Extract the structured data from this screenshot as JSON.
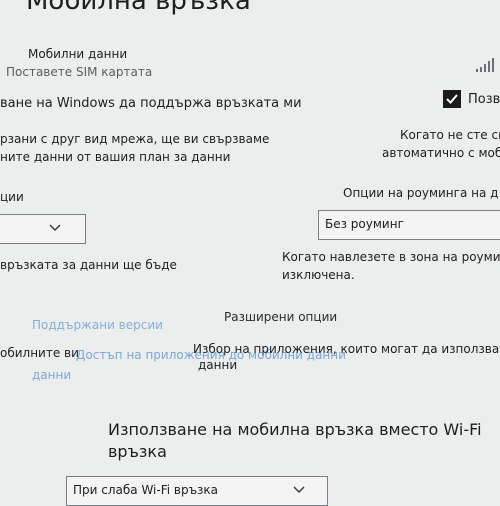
{
  "page": {
    "title": "Мобилна връзка"
  },
  "mobile_data": {
    "label": "Мобилни данни",
    "status": "Поставете SIM картата",
    "signal_icon": "signal-bars-icon"
  },
  "windows_manage": {
    "label_left": "ване на Windows да поддържа връзката ми",
    "checkbox_label": "Позво",
    "checked": true
  },
  "auto_switch": {
    "left_line1": "рзани с друг вид мрежа, ще ви свързваме",
    "left_line2": "ните данни от вашия план за данни",
    "right_line1": "Когато не сте св",
    "right_line2": "автоматично с моб"
  },
  "roaming": {
    "options_label": "Опции на роуминга на д",
    "left_label": "ции",
    "dropdown_value": "Без роуминг",
    "left_dropdown_value": "",
    "info_line1": "Когато навлезете в зона на роуминг",
    "info_line2": "изключена.",
    "left_info": "връзката за данни ще бъде"
  },
  "advanced": {
    "label": "Разширени опции",
    "left_link": "Поддържани версии",
    "apps_line1": "Избор на приложения, които могат да използват м",
    "apps_line2": "данни",
    "left_text": "обилните ви",
    "apps_link": "Достъп на приложения до мобилни данни",
    "left_link2": "данни"
  },
  "wifi_fallback": {
    "heading_line1": "Използване на мобилна връзка вместо Wi-Fi",
    "heading_line2": "връзка",
    "dropdown_value": "При слаба Wi-Fi връзка"
  }
}
